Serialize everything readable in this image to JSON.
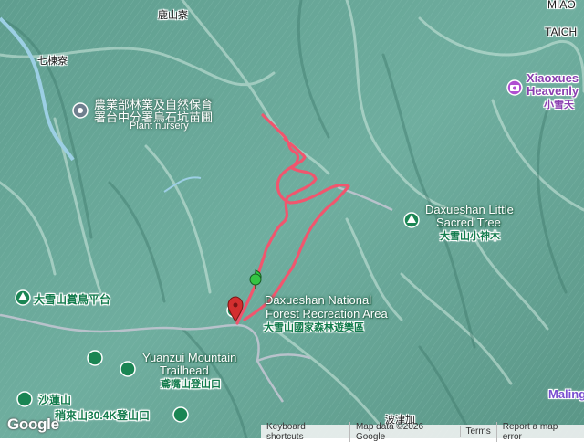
{
  "map": {
    "background": "#6aa89a",
    "ridge_color": "#d8efe6",
    "valley_color": "#4c8b7d",
    "track_color": "#f0566e",
    "road_color": "#b9c3cc"
  },
  "places": {
    "top_left_village": "鹿山寮",
    "qiliao": "七棟寮",
    "miaoli_cut": "MIAO",
    "taichung_cut": "TAICH",
    "bolang": "波津加"
  },
  "pois": {
    "nursery_zh1": "農業部林業及自然保育",
    "nursery_zh2": "署台中分署烏石坑苗圃",
    "nursery_en": "Plant nursery",
    "xiaoxue_en1": "Xiaoxues",
    "xiaoxue_en2": "Heavenly",
    "xiaoxue_zh": "小雪天",
    "sacred_en1": "Daxueshan Little",
    "sacred_en2": "Sacred Tree",
    "sacred_zh": "大雪山小神木",
    "park_en1": "Daxueshan National",
    "park_en2": "Forest Recreation Area",
    "park_zh": "大雪山國家森林遊樂區",
    "birding_zh": "大雪山賞鳥平台",
    "yuanzui_en1": "Yuanzui Mountain",
    "yuanzui_en2": "Trailhead",
    "yuanzui_zh": "鳶嘴山登山口",
    "shalian_zh": "沙蓮山",
    "jilai_zh": "稍來山30.4K登山口",
    "maling_cut": "Maling"
  },
  "footer": {
    "logo": "Google",
    "shortcuts": "Keyboard shortcuts",
    "map_data": "Map data ©2026 Google",
    "terms": "Terms",
    "report": "Report a map error"
  },
  "icons": {
    "start_marker": "green-flag-marker",
    "end_marker": "red-pin-marker",
    "nursery": "info-dot-icon",
    "xiaoxue": "camera-icon",
    "tree": "tree-icon",
    "trailhead": "hiker-icon"
  }
}
